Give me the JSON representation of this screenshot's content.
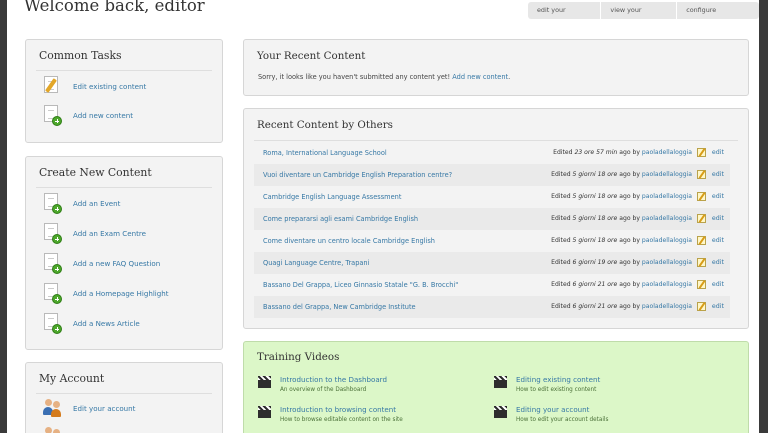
{
  "page": {
    "title": "Welcome back, editor",
    "links": [
      "edit your account",
      "view your account",
      "configure dashboard"
    ]
  },
  "common_tasks": {
    "title": "Common Tasks",
    "items": [
      {
        "label": "Edit existing content",
        "icon": "edit-document-icon"
      },
      {
        "label": "Add new content",
        "icon": "add-document-icon"
      }
    ]
  },
  "create_new": {
    "title": "Create New Content",
    "items": [
      {
        "label": "Add an Event",
        "icon": "add-document-icon"
      },
      {
        "label": "Add an Exam Centre",
        "icon": "add-document-icon"
      },
      {
        "label": "Add a new FAQ Question",
        "icon": "add-document-icon"
      },
      {
        "label": "Add a Homepage Highlight",
        "icon": "add-document-icon"
      },
      {
        "label": "Add a News Article",
        "icon": "add-document-icon"
      }
    ]
  },
  "my_account": {
    "title": "My Account",
    "items": [
      {
        "label": "Edit your account",
        "icon": "users-icon"
      }
    ]
  },
  "your_recent": {
    "title": "Your Recent Content",
    "message": "Sorry, it looks like you haven't submitted any content yet!",
    "link": "Add new content",
    "period": "."
  },
  "recent_others": {
    "title": "Recent Content by Others",
    "rows": [
      {
        "title": "Roma, International Language School",
        "prefix": "Edited",
        "time": "23 ore 57 min",
        "suffix": "ago by",
        "user": "paoladellaloggia",
        "edit": "edit"
      },
      {
        "title": "Vuoi diventare un Cambridge English Preparation centre?",
        "prefix": "Edited",
        "time": "5 giorni 18 ore",
        "suffix": "ago by",
        "user": "paoladellaloggia",
        "edit": "edit"
      },
      {
        "title": "Cambridge English Language Assessment",
        "prefix": "Edited",
        "time": "5 giorni 18 ore",
        "suffix": "ago by",
        "user": "paoladellaloggia",
        "edit": "edit"
      },
      {
        "title": "Come prepararsi agli esami Cambridge English",
        "prefix": "Edited",
        "time": "5 giorni 18 ore",
        "suffix": "ago by",
        "user": "paoladellaloggia",
        "edit": "edit"
      },
      {
        "title": "Come diventare un centro locale Cambridge English",
        "prefix": "Edited",
        "time": "5 giorni 18 ore",
        "suffix": "ago by",
        "user": "paoladellaloggia",
        "edit": "edit"
      },
      {
        "title": "Quagi Language Centre, Trapani",
        "prefix": "Edited",
        "time": "6 giorni 19 ore",
        "suffix": "ago by",
        "user": "paoladellaloggia",
        "edit": "edit"
      },
      {
        "title": "Bassano Del Grappa, Liceo Ginnasio Statale \"G. B. Brocchi\"",
        "prefix": "Edited",
        "time": "6 giorni 21 ore",
        "suffix": "ago by",
        "user": "paoladellaloggia",
        "edit": "edit"
      },
      {
        "title": "Bassano del Grappa, New Cambridge Institute",
        "prefix": "Edited",
        "time": "6 giorni 21 ore",
        "suffix": "ago by",
        "user": "paoladellaloggia",
        "edit": "edit"
      }
    ]
  },
  "training": {
    "title": "Training Videos",
    "videos": [
      {
        "title": "Introduction to the Dashboard",
        "sub": "An overview of the Dashboard"
      },
      {
        "title": "Editing existing content",
        "sub": "How to edit existing content"
      },
      {
        "title": "Introduction to browsing content",
        "sub": "How to browse editable content on the site"
      },
      {
        "title": "Editing your account",
        "sub": "How to edit your account details"
      }
    ]
  },
  "colors": {
    "link": "#3678a5",
    "panel_bg": "#f3f3f3",
    "training_bg": "#dcf7c8"
  }
}
